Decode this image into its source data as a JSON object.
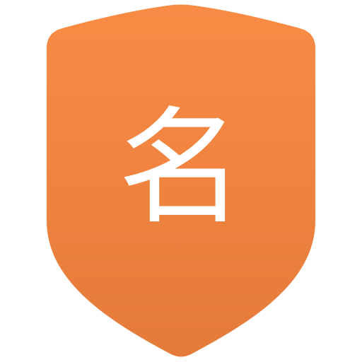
{
  "icon": {
    "semantic": "shield-icon",
    "glyph": "名",
    "colors": {
      "gradient_top": "#F98B45",
      "gradient_bottom": "#E57B3A",
      "glyph": "#FFFFFF"
    }
  }
}
